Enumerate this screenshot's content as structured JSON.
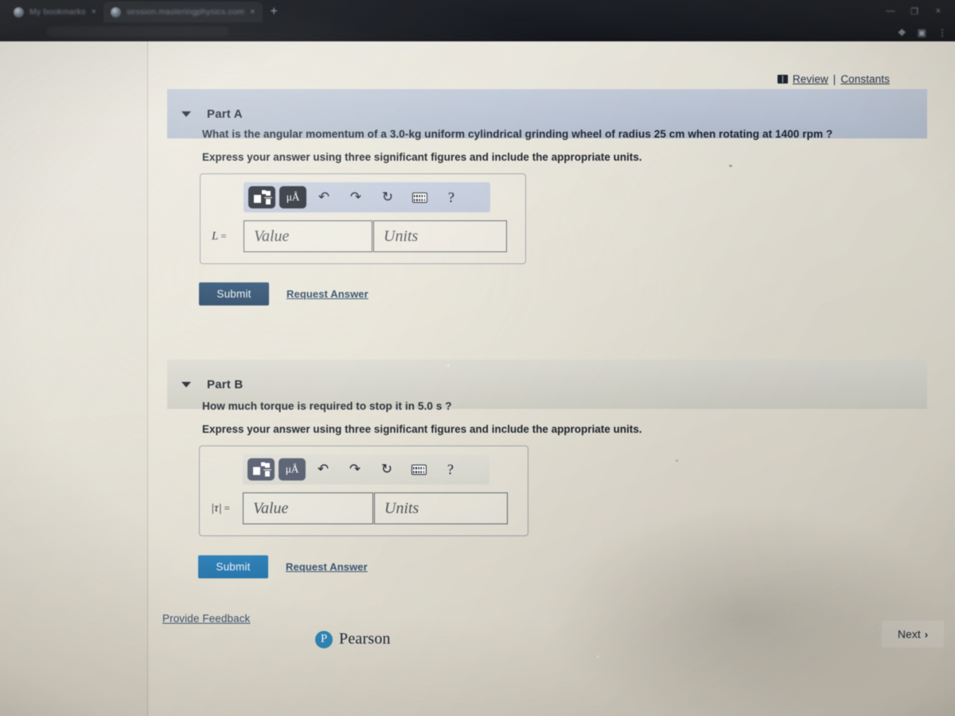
{
  "browser": {
    "tabs": [
      {
        "title": "My bookmarks",
        "favicon": "globe-icon",
        "close": "×",
        "active": false
      },
      {
        "title": "session.masteringphysics.com",
        "favicon": "site-favicon",
        "close": "×",
        "active": true
      }
    ],
    "new_tab_label": "+",
    "window_controls": {
      "minimize": "—",
      "maximize": "❐",
      "close": "×"
    },
    "right_icons": {
      "extension": "❖",
      "profile": "▣",
      "menu": "⋮"
    }
  },
  "header": {
    "book_icon": "book-icon",
    "review_label": "Review",
    "separator": "|",
    "constants_label": "Constants"
  },
  "parts": [
    {
      "id": "part-a",
      "caret": "caret-down-icon",
      "title": "Part A",
      "question": "What is the angular momentum of a 3.0-kg uniform cylindrical grinding wheel of radius 25 cm when rotating at 1400 rpm ?",
      "instruction": "Express your answer using three significant figures and include the appropriate units.",
      "toolbar": {
        "template_icon": "math-template-icon",
        "units_icon": "μÅ",
        "undo_icon": "↶",
        "redo_icon": "↷",
        "reset_icon": "↻",
        "keyboard_icon": "keyboard-icon",
        "help_icon": "?"
      },
      "field_label": "L",
      "field_equals": "=",
      "value_placeholder": "Value",
      "units_placeholder": "Units",
      "value": "",
      "units": "",
      "submit_label": "Submit",
      "request_label": "Request Answer",
      "header_color": "#bcc6d6",
      "submit_color": "#1c3d60"
    },
    {
      "id": "part-b",
      "caret": "caret-down-icon",
      "title": "Part B",
      "question": "How much torque is required to stop it in 5.0 s ?",
      "instruction": "Express your answer using three significant figures and include the appropriate units.",
      "toolbar": {
        "template_icon": "math-template-icon",
        "units_icon": "μÅ",
        "undo_icon": "↶",
        "redo_icon": "↷",
        "reset_icon": "↻",
        "keyboard_icon": "keyboard-icon",
        "help_icon": "?"
      },
      "field_label": "|τ|",
      "field_equals": "=",
      "value_placeholder": "Value",
      "units_placeholder": "Units",
      "value": "",
      "units": "",
      "submit_label": "Submit",
      "request_label": "Request Answer",
      "header_color": "#d6d5cd",
      "submit_color": "#2a77ac"
    }
  ],
  "footer": {
    "provide_feedback_label": "Provide Feedback",
    "brand_mark": "pearson-p-icon",
    "brand_name": "Pearson",
    "next_label": "Next",
    "next_chevron": "›"
  }
}
